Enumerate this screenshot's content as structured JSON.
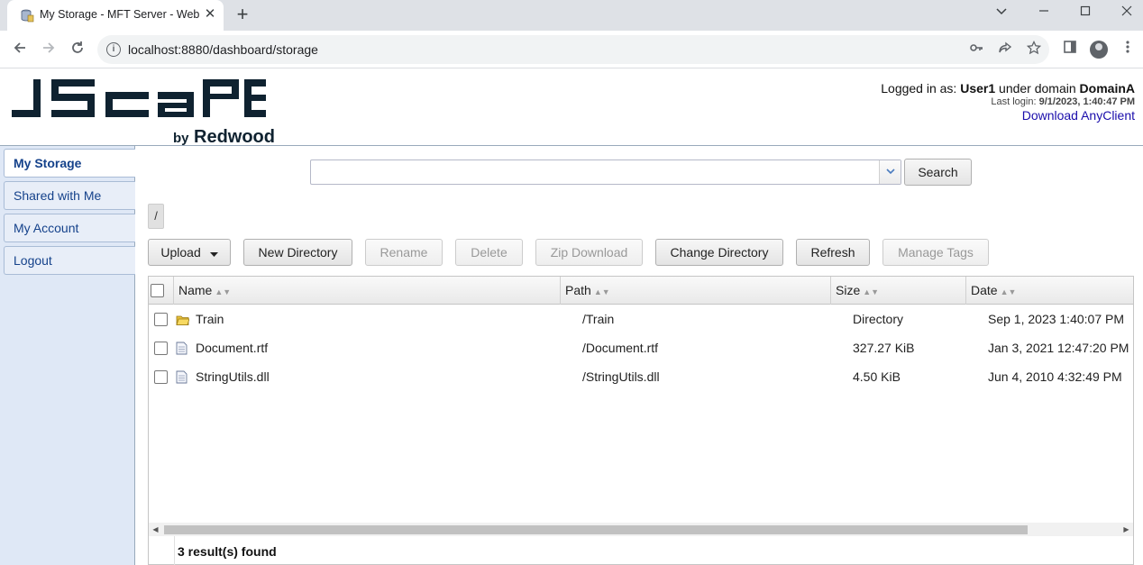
{
  "browser": {
    "tab_title": "My Storage - MFT Server - Web",
    "url": "localhost:8880/dashboard/storage"
  },
  "header": {
    "logo_by": "by",
    "logo_brand": "Redwood",
    "logged_in_prefix": "Logged in as: ",
    "user": "User1",
    "domain_prefix": " under domain ",
    "domain": "DomainA",
    "last_login_label": "Last login: ",
    "last_login_value": "9/1/2023, 1:40:47 PM",
    "download_link": "Download AnyClient"
  },
  "sidebar": {
    "items": [
      {
        "label": "My Storage"
      },
      {
        "label": "Shared with Me"
      },
      {
        "label": "My Account"
      },
      {
        "label": "Logout"
      }
    ]
  },
  "search": {
    "value": "",
    "button": "Search"
  },
  "breadcrumb": "/",
  "toolbar": {
    "upload": "Upload",
    "new_directory": "New Directory",
    "rename": "Rename",
    "delete": "Delete",
    "zip_download": "Zip Download",
    "change_directory": "Change Directory",
    "refresh": "Refresh",
    "manage_tags": "Manage Tags"
  },
  "grid": {
    "columns": {
      "name": "Name",
      "path": "Path",
      "size": "Size",
      "date": "Date"
    },
    "rows": [
      {
        "name": "Train",
        "path": "/Train",
        "size": "Directory",
        "date": "Sep 1, 2023 1:40:07 PM",
        "icon": "folder-icon"
      },
      {
        "name": "Document.rtf",
        "path": "/Document.rtf",
        "size": "327.27 KiB",
        "date": "Jan 3, 2021 12:47:20 PM",
        "icon": "file-icon"
      },
      {
        "name": "StringUtils.dll",
        "path": "/StringUtils.dll",
        "size": "4.50 KiB",
        "date": "Jun 4, 2010 4:32:49 PM",
        "icon": "file-icon"
      }
    ],
    "footer": "3 result(s) found"
  }
}
